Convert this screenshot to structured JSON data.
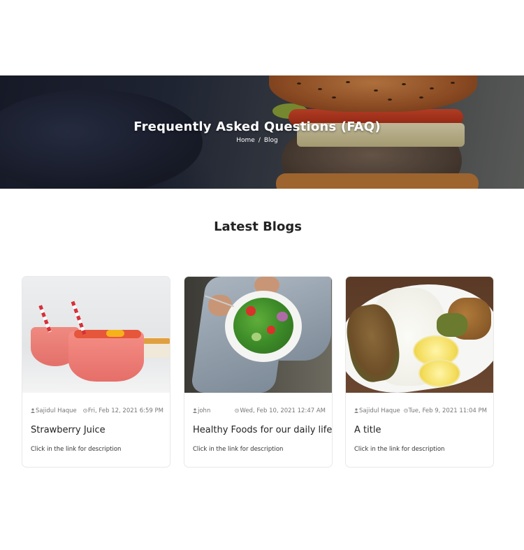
{
  "hero": {
    "title": "Frequently Asked Questions (FAQ)",
    "breadcrumb": {
      "home": "Home",
      "separator": "/",
      "current": "Blog"
    }
  },
  "section": {
    "title": "Latest Blogs"
  },
  "posts": [
    {
      "author": "Sajidul Haque",
      "date": "Fri, Feb 12, 2021 6:59 PM",
      "title": "Strawberry Juice",
      "description": "Click in the link for description",
      "image": "strawberry-juice-image"
    },
    {
      "author": "john",
      "date": "Wed, Feb 10, 2021 12:47 AM",
      "title": "Healthy Foods for our daily life",
      "description": "Click in the link for description",
      "image": "salad-plate-image"
    },
    {
      "author": "Sajidul Haque",
      "date": "Tue, Feb 9, 2021 11:04 PM",
      "title": "A title",
      "description": "Click in the link for description",
      "image": "rice-and-fish-image"
    }
  ],
  "icons": {
    "author": "user-icon",
    "date": "clock-icon"
  },
  "colors": {
    "heading": "#222222",
    "meta": "#777777",
    "card_border": "#e8e8e8"
  }
}
